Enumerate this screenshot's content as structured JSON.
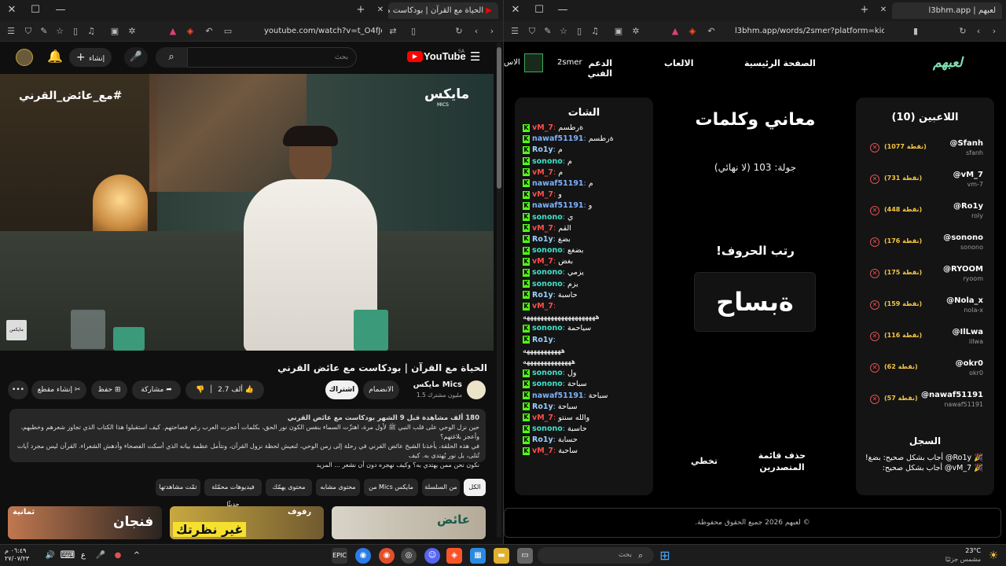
{
  "left_browser": {
    "tab": {
      "title": "الحياة مع القرآن | بودكاست مع ع..."
    },
    "url": "youtube.com/watch?v=t_O4fJozLdU",
    "youtube": {
      "logo": "YouTube",
      "country": "SA",
      "search_placeholder": "بحث",
      "create_label": "إنشاء",
      "video_overlay_left": "#مع_عائض_القرني",
      "video_overlay_right": "مايكس",
      "video_overlay_sub": "MICS",
      "watermark": "مايكس",
      "video_title": "الحياة مع القرآن | بودكاست مع عائض القرني",
      "channel_name": "مايكس Mics",
      "subscribers": "1.5 مليون مشترك",
      "join_label": "الانضمام",
      "subscribe_label": "اشتراك",
      "likes": "2.7 ألف",
      "share_label": "مشاركة",
      "save_label": "حفظ",
      "clip_label": "إنشاء مقطع",
      "description_meta": "180 ألف مشاهدة  قبل 9 الشهر  بودكاست مع عائض القرني",
      "description_line1": "حين نزل الوحي على قلب النبي ﷺ لأول مرة، اهتزّت السماء بنفس الكون نور الحق، بكلمات أعجزت العرب رغم فصاحتهم. كيف استقبلوا هذا الكتاب الذي تجاوز شعرهم وخطبهم، وأعجز بلاغتهم؟",
      "description_line2": "في هذه الحلقة، يأخذنا الشيخ عائض القرني في رحلة إلى زمن الوحي، لنعيش لحظة نزول القرآن، ونتأمل عظمة بيانه الذي أسكت الفصحاء وأدهش الشعراء. القرآن ليس مجرد آيات تُتلى، بل نور يُهتدى به. كيف",
      "description_line3": "نكون نحن ممن يهتدي به؟ وكيف نهجره دون أن نشعر ... المزيد",
      "chips": [
        "الكل",
        "من السلسلة",
        "من Mics مايكس",
        "محتوى مشابه",
        "محتوى يهمّك",
        "فيديوهات محمّلة حديثًا",
        "تمّت مشاهدتها"
      ],
      "thumb_texts": [
        "عائض",
        "رفوف",
        "غير نظرتك",
        "فنجان",
        "ثمانية"
      ]
    }
  },
  "right_browser": {
    "tab": {
      "title": "لعبهم | l3bhm.app"
    },
    "url": "l3bhm.app/words/2smer?platform=kick",
    "nav": {
      "logo": "لعبهم",
      "home": "الصفحة الرئيسية",
      "games": "الالعاب",
      "support": "الدعم الفني",
      "user": "2smer",
      "extra": "الاس"
    },
    "players_title": "اللاعبين (10)",
    "players": [
      {
        "name": "@Sfanh",
        "user": "sfanh",
        "points": "(1077 نقطة)"
      },
      {
        "name": "@vM_7",
        "user": "vm-7",
        "points": "(731 نقطة)"
      },
      {
        "name": "@Ro1y",
        "user": "roly",
        "points": "(448 نقطة)"
      },
      {
        "name": "@sonono",
        "user": "sonono",
        "points": "(176 نقطة)"
      },
      {
        "name": "@RYOOM",
        "user": "ryoom",
        "points": "(175 نقطة)"
      },
      {
        "name": "@Nola_x",
        "user": "nola-x",
        "points": "(159 نقطة)"
      },
      {
        "name": "@IlLwa",
        "user": "illwa",
        "points": "(116 نقطة)"
      },
      {
        "name": "@okr0",
        "user": "okr0",
        "points": "(62 نقطة)"
      },
      {
        "name": "@nawaf51191",
        "user": "nawaf51191",
        "points": "(57 نقطة)"
      }
    ],
    "log_title": "السجل",
    "log_entries": [
      "🎉 Ro1y@ أجاب بشكل صحيح: بضغ!",
      "🎉 vM_7@ أجاب بشكل صحيح:"
    ],
    "game_title": "معاني وكلمات",
    "round": "جولة: 103 (لا نهائي)",
    "instruction": "رتب الحروف!",
    "scrambled": "ةبساح",
    "skip_label": "تخطي",
    "delete_label": "حذف قائمة المتصدرين",
    "chat_title": "الشات",
    "chat": [
      {
        "u": "vM_7",
        "t": "ةرطسم",
        "c": "#ff4d4d"
      },
      {
        "u": "nawaf51191",
        "t": "ةرطسم",
        "c": "#7fb2ff"
      },
      {
        "u": "Ro1y",
        "t": "م",
        "c": "#9ad0ff"
      },
      {
        "u": "sonono",
        "t": "م",
        "c": "#3fe0c8"
      },
      {
        "u": "vM_7",
        "t": "م",
        "c": "#ff4d4d"
      },
      {
        "u": "nawaf51191",
        "t": "م",
        "c": "#7fb2ff"
      },
      {
        "u": "vM_7",
        "t": "و",
        "c": "#ff4d4d"
      },
      {
        "u": "nawaf51191",
        "t": "و",
        "c": "#7fb2ff"
      },
      {
        "u": "sonono",
        "t": "ي",
        "c": "#3fe0c8"
      },
      {
        "u": "vM_7",
        "t": "القم",
        "c": "#ff4d4d"
      },
      {
        "u": "Ro1y",
        "t": "بضغ",
        "c": "#9ad0ff"
      },
      {
        "u": "sonono",
        "t": "بضغع",
        "c": "#3fe0c8"
      },
      {
        "u": "vM_7",
        "t": "بغض",
        "c": "#ff4d4d"
      },
      {
        "u": "sonono",
        "t": "يزمي",
        "c": "#3fe0c8"
      },
      {
        "u": "sonono",
        "t": "يزم",
        "c": "#3fe0c8"
      },
      {
        "u": "Ro1y",
        "t": "حاسبة",
        "c": "#9ad0ff"
      },
      {
        "u": "vM_7",
        "t": "",
        "c": "#ff4d4d"
      },
      {
        "u": "",
        "t": "هههههههههههههههههههههه",
        "c": "#fff"
      },
      {
        "u": "sonono",
        "t": "سياحمة",
        "c": "#3fe0c8"
      },
      {
        "u": "Ro1y",
        "t": "",
        "c": "#9ad0ff"
      },
      {
        "u": "",
        "t": "هههههههههههه",
        "c": "#fff"
      },
      {
        "u": "",
        "t": "ههههههههههههههه",
        "c": "#fff"
      },
      {
        "u": "sonono",
        "t": "ول",
        "c": "#3fe0c8"
      },
      {
        "u": "sonono",
        "t": "سباحة",
        "c": "#3fe0c8"
      },
      {
        "u": "nawaf51191",
        "t": "سباحة",
        "c": "#7fb2ff"
      },
      {
        "u": "Ro1y",
        "t": "سباحة",
        "c": "#9ad0ff"
      },
      {
        "u": "vM_7",
        "t": "والله سنتو",
        "c": "#ff4d4d"
      },
      {
        "u": "sonono",
        "t": "حاسبة",
        "c": "#3fe0c8"
      },
      {
        "u": "Ro1y",
        "t": "حسابة",
        "c": "#9ad0ff"
      },
      {
        "u": "vM_7",
        "t": "ساحبة",
        "c": "#ff4d4d"
      }
    ],
    "footer": "© لعبهم 2026 جميع الحقوق محفوظة."
  },
  "taskbar": {
    "weather_temp": "23°C",
    "weather_desc": "مشمس جزئيًا",
    "search_placeholder": "بحث",
    "time": "٠٦:٤٩ م",
    "date": "٢٧/٠٧/٢٣",
    "lang": "ع"
  }
}
